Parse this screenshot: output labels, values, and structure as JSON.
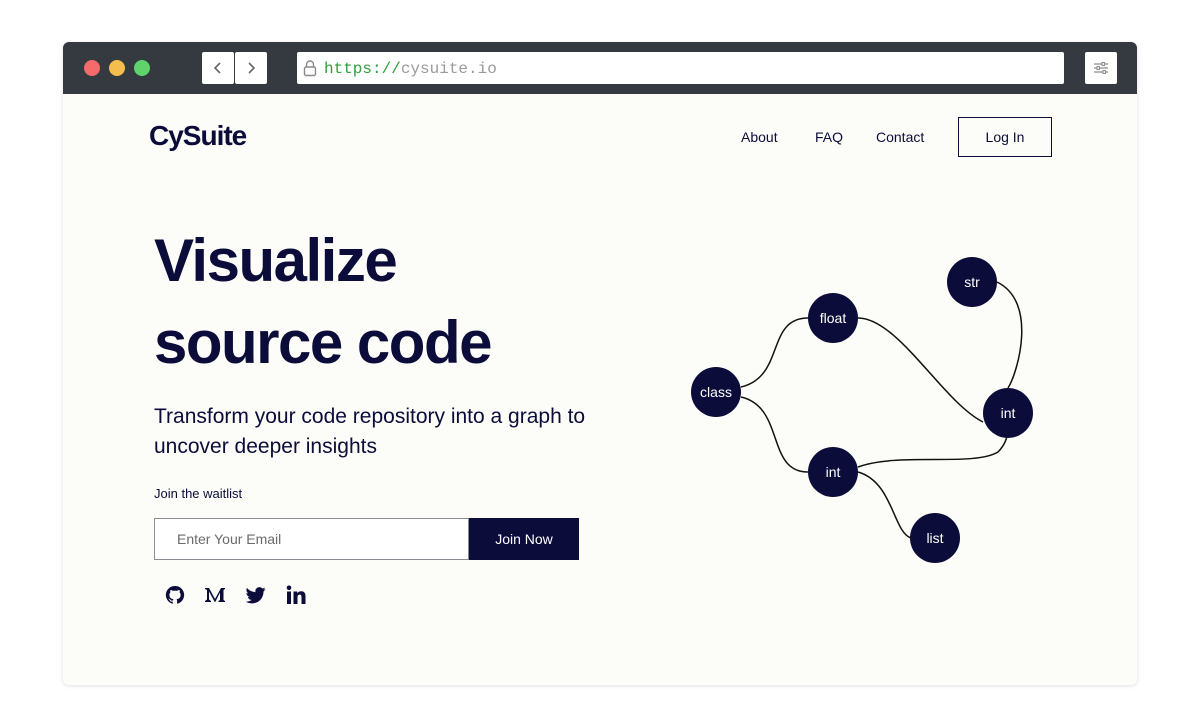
{
  "browser": {
    "url_scheme": "https://",
    "url_host": "cysuite.io",
    "traffic_lights": [
      "#f36b6b",
      "#f4be4f",
      "#5fd46a"
    ],
    "icons": [
      "back-arrow-icon",
      "forward-arrow-icon",
      "lock-icon",
      "settings-icon"
    ]
  },
  "header": {
    "logo": "CySuite",
    "nav": {
      "about": "About",
      "faq": "FAQ",
      "contact": "Contact"
    },
    "login_label": "Log In"
  },
  "hero": {
    "title_line1": "Visualize",
    "title_line2": "source code",
    "subtitle": "Transform your code repository into a graph to uncover deeper insights",
    "waitlist_label": "Join the waitlist",
    "email_placeholder": "Enter Your Email",
    "join_label": "Join Now"
  },
  "social": [
    "github-icon",
    "medium-icon",
    "twitter-icon",
    "linkedin-icon"
  ],
  "graph": {
    "node_color": "#0b0c3a",
    "nodes": [
      {
        "id": "class",
        "label": "class"
      },
      {
        "id": "float",
        "label": "float"
      },
      {
        "id": "int1",
        "label": "int"
      },
      {
        "id": "str",
        "label": "str"
      },
      {
        "id": "int2",
        "label": "int"
      },
      {
        "id": "list",
        "label": "list"
      }
    ],
    "edges": [
      [
        "class",
        "float"
      ],
      [
        "class",
        "int1"
      ],
      [
        "float",
        "int2"
      ],
      [
        "str",
        "int2"
      ],
      [
        "int1",
        "int2"
      ],
      [
        "int1",
        "list"
      ]
    ]
  },
  "colors": {
    "accent": "#0b0c3a",
    "page_bg": "#fcfcf8",
    "chrome": "#343a40",
    "url_scheme": "#2e9e3e"
  }
}
